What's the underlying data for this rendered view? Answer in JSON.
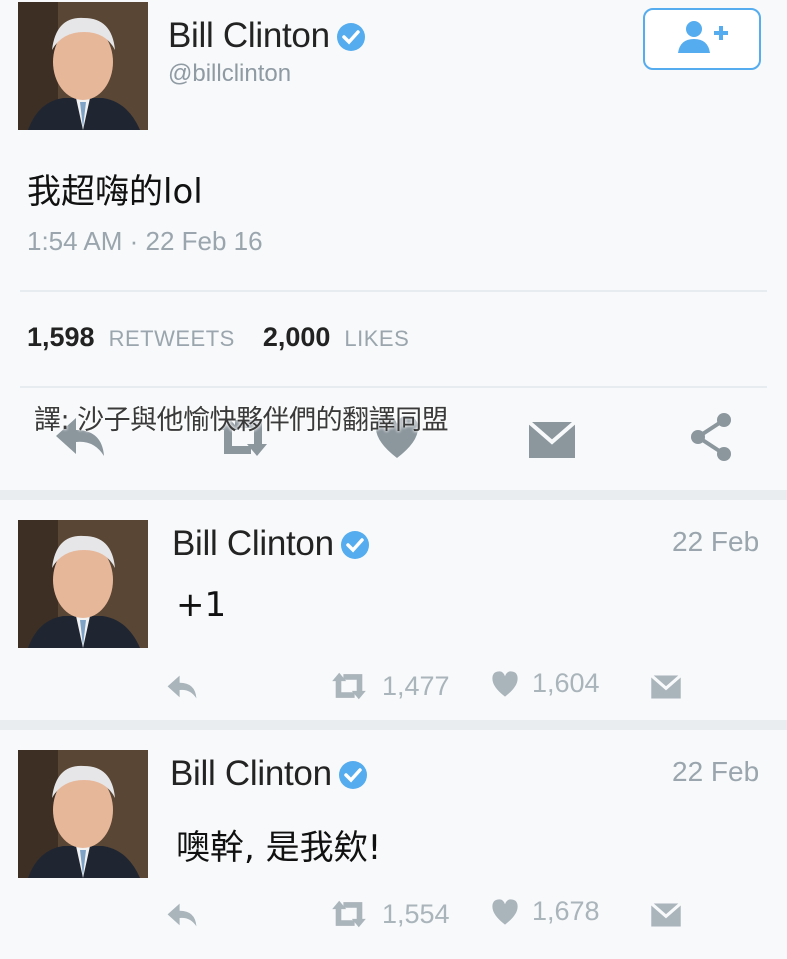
{
  "main_tweet": {
    "user": {
      "name": "Bill Clinton",
      "handle": "@billclinton"
    },
    "text": "我超嗨的lol",
    "timestamp": "1:54 AM · 22 Feb 16",
    "retweets": "1,598",
    "retweets_label": "RETWEETS",
    "likes": "2,000",
    "likes_label": "LIKES",
    "actions": [
      "reply-icon",
      "retweet-icon",
      "heart-icon",
      "message-icon",
      "share-icon"
    ]
  },
  "overlay_text": "譯: 沙子與他愉快夥伴們的翻譯同盟",
  "replies": [
    {
      "name": "Bill Clinton",
      "date": "22 Feb",
      "text": "+1",
      "retweets": "1,477",
      "likes": "1,604"
    },
    {
      "name": "Bill Clinton",
      "date": "22 Feb",
      "text": "噢幹, 是我欸!",
      "retweets": "1,554",
      "likes": "1,678"
    }
  ],
  "colors": {
    "accent": "#55acee",
    "muted": "#9aa5ad",
    "icon": "#aab4bb",
    "divider": "#e6ecf0"
  }
}
